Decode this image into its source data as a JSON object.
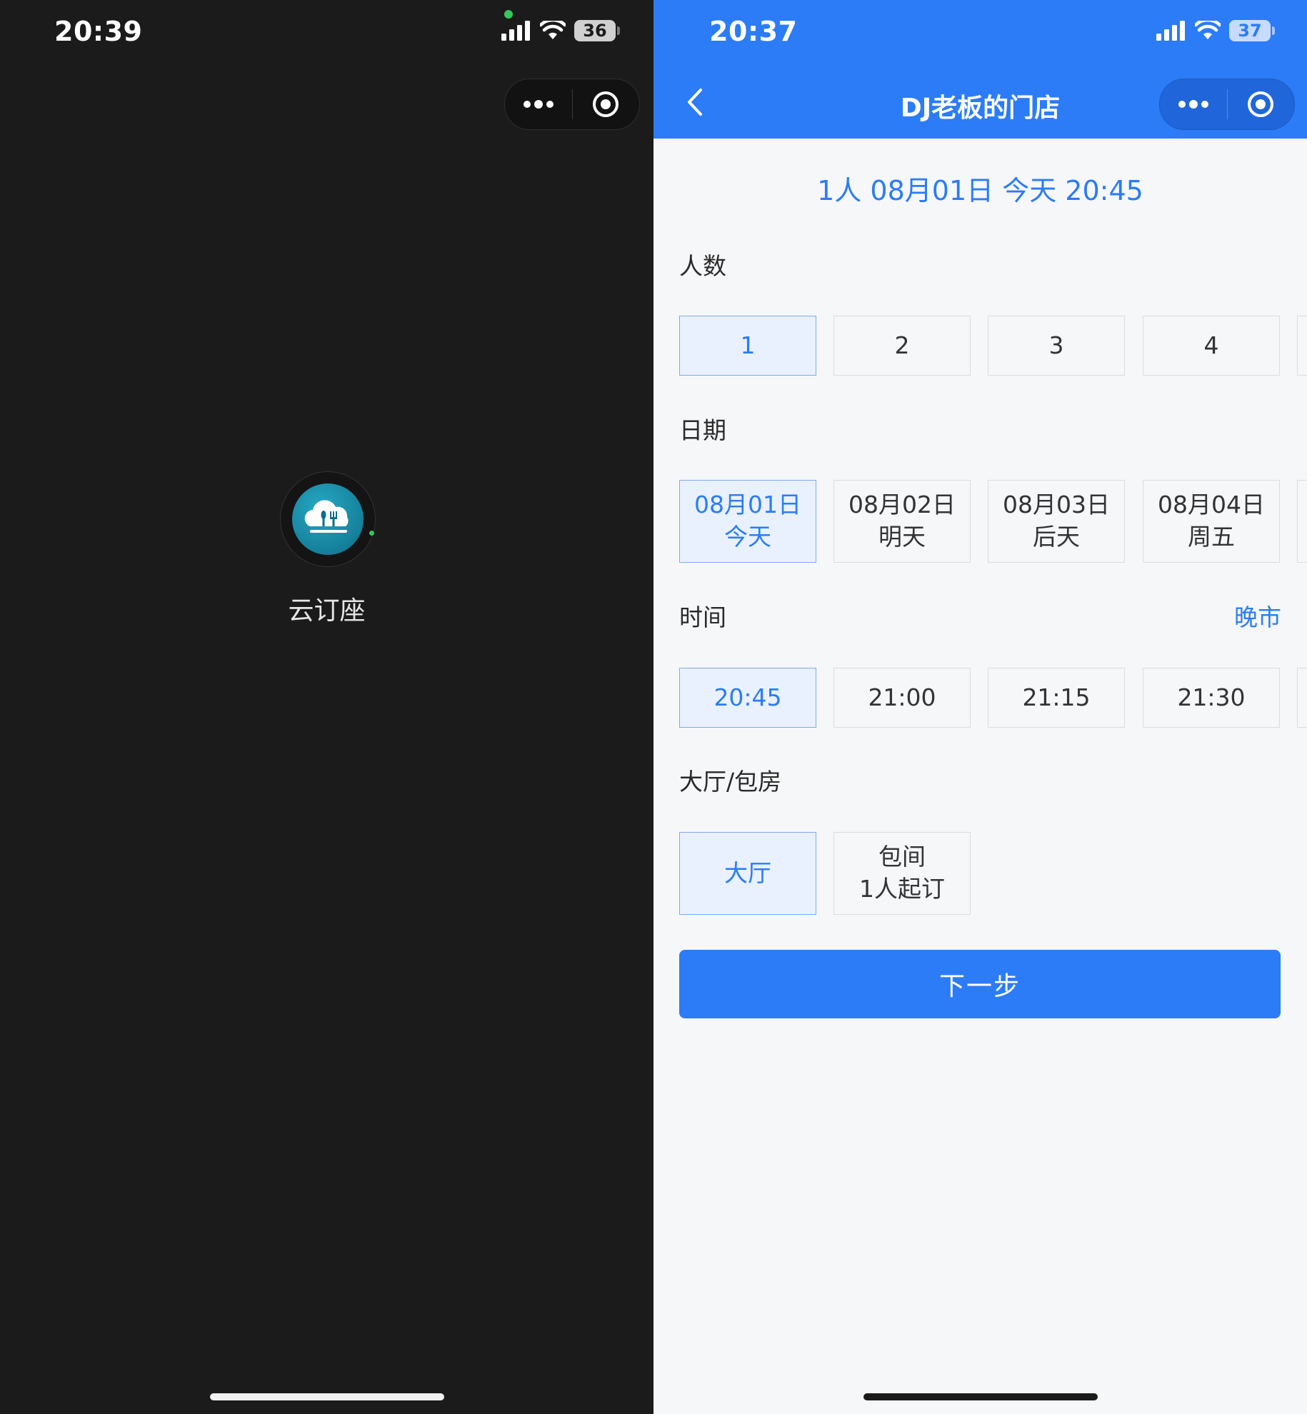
{
  "left": {
    "status_bar": {
      "time": "20:39",
      "battery": "36"
    },
    "app_name": "云订座"
  },
  "right": {
    "status_bar": {
      "time": "20:37",
      "battery": "37"
    },
    "nav": {
      "title": "DJ老板的门店"
    },
    "summary": "1人 08月01日 今天 20:45",
    "people": {
      "label": "人数",
      "options": [
        "1",
        "2",
        "3",
        "4"
      ],
      "selected": "1"
    },
    "date": {
      "label": "日期",
      "options": [
        {
          "date": "08月01日",
          "day": "今天"
        },
        {
          "date": "08月02日",
          "day": "明天"
        },
        {
          "date": "08月03日",
          "day": "后天"
        },
        {
          "date": "08月04日",
          "day": "周五"
        }
      ],
      "selected": "08月01日"
    },
    "time": {
      "label": "时间",
      "period": "晚市",
      "options": [
        "20:45",
        "21:00",
        "21:15",
        "21:30"
      ],
      "selected": "20:45"
    },
    "room": {
      "label": "大厅/包房",
      "options": [
        {
          "name": "大厅"
        },
        {
          "name": "包间",
          "note": "1人起订"
        }
      ],
      "selected": "大厅"
    },
    "next_button": "下一步"
  },
  "colors": {
    "accent": "#2b7cf6",
    "selected_bg": "#e9f1ff",
    "dark_bg": "#1b1b1b",
    "page_bg": "#f6f7f9"
  }
}
